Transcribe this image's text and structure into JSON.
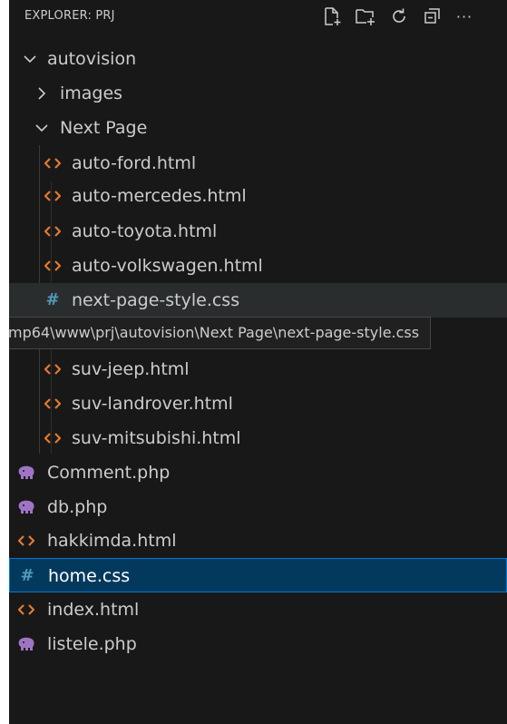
{
  "explorer": {
    "title": "EXPLORER: PRJ",
    "toolbar": [
      {
        "name": "new-file-icon"
      },
      {
        "name": "new-folder-icon"
      },
      {
        "name": "refresh-icon"
      },
      {
        "name": "collapse-all-icon"
      },
      {
        "name": "more-actions-icon",
        "glyph": "···"
      }
    ]
  },
  "tree": {
    "root": {
      "label": "autovision",
      "expanded": true
    },
    "images_folder": {
      "label": "images",
      "expanded": false
    },
    "next_page_folder": {
      "label": "Next Page",
      "expanded": true
    },
    "next_page_files": [
      {
        "label": "auto-ford.html",
        "type": "html"
      },
      {
        "label": "auto-mercedes.html",
        "type": "html"
      },
      {
        "label": "auto-toyota.html",
        "type": "html"
      },
      {
        "label": "auto-volkswagen.html",
        "type": "html"
      },
      {
        "label": "next-page-style.css",
        "type": "css"
      },
      {
        "label": "suv-jeep.html",
        "type": "html"
      },
      {
        "label": "suv-landrover.html",
        "type": "html"
      },
      {
        "label": "suv-mitsubishi.html",
        "type": "html"
      }
    ],
    "root_files": [
      {
        "label": "Comment.php",
        "type": "php"
      },
      {
        "label": "db.php",
        "type": "php"
      },
      {
        "label": "hakkimda.html",
        "type": "html"
      },
      {
        "label": "home.css",
        "type": "css",
        "selected": true
      },
      {
        "label": "index.html",
        "type": "html"
      },
      {
        "label": "listele.php",
        "type": "php"
      }
    ]
  },
  "tooltip": {
    "text": "mp64\\www\\prj\\autovision\\Next Page\\next-page-style.css"
  },
  "colors": {
    "background": "#181818",
    "html_icon": "#e37933",
    "css_icon": "#519aba",
    "php_icon": "#a074c4",
    "selected_bg": "#04395e",
    "selected_border": "#0078d4"
  }
}
